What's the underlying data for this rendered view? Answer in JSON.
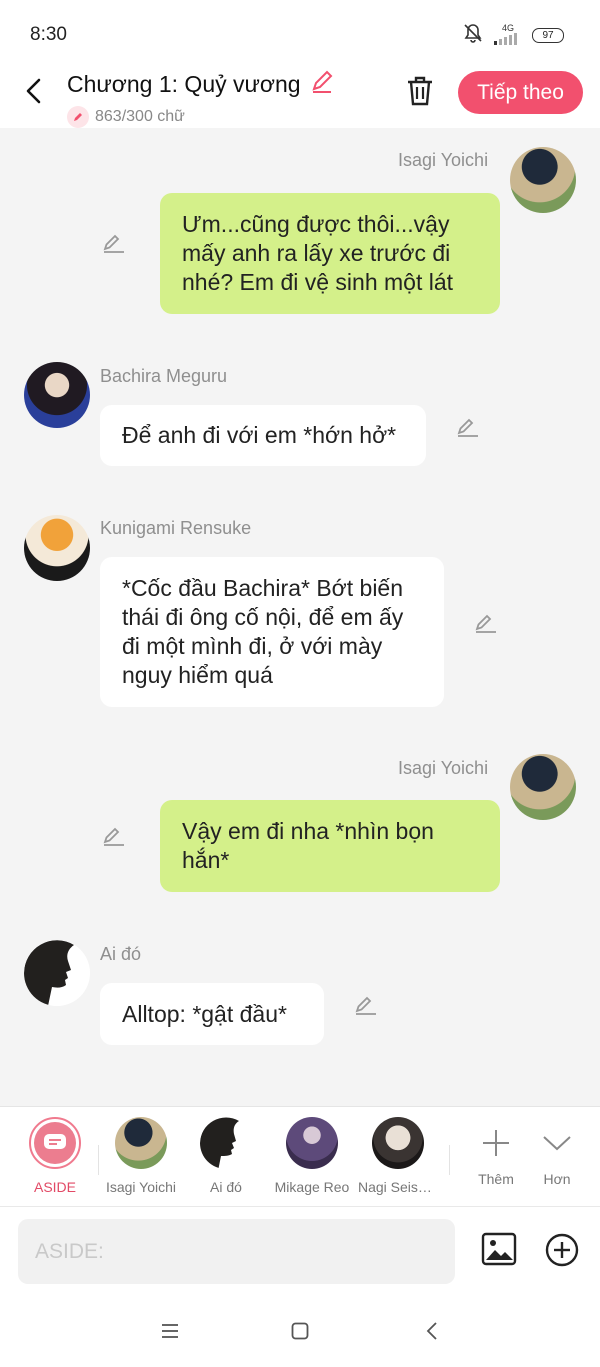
{
  "status": {
    "time": "8:30",
    "network": "4G",
    "battery": "97"
  },
  "header": {
    "title": "Chương 1: Quỷ vương",
    "word_count": "863/300 chữ",
    "next_label": "Tiếp theo"
  },
  "messages": [
    {
      "speaker": "Isagi Yoichi",
      "side": "right",
      "text": "Ưm...cũng được thôi...vậy mấy anh ra lấy xe trước đi nhé? Em đi vệ sinh một lát"
    },
    {
      "speaker": "Bachira Meguru",
      "side": "left",
      "text": "Để anh đi với em *hớn hở*"
    },
    {
      "speaker": "Kunigami Rensuke",
      "side": "left",
      "text": "*Cốc đầu Bachira* Bớt biến thái đi ông cố nội, để em ấy đi một mình đi, ở với mày nguy hiểm quá"
    },
    {
      "speaker": "Isagi Yoichi",
      "side": "right",
      "text": "Vậy em đi nha *nhìn bọn hắn*"
    },
    {
      "speaker": "Ai đó",
      "side": "left",
      "text": "Alltop: *gật đầu*"
    }
  ],
  "roster": {
    "items": [
      {
        "label": "ASIDE"
      },
      {
        "label": "Isagi Yoichi"
      },
      {
        "label": "Ai đó"
      },
      {
        "label": "Mikage Reo"
      },
      {
        "label": "Nagi Seishiro"
      }
    ],
    "add_label": "Thêm",
    "more_label": "Hơn"
  },
  "composer": {
    "placeholder": "ASIDE:"
  },
  "colors": {
    "accent": "#f2506e",
    "bubble_right": "#d4f08a",
    "bubble_left": "#ffffff",
    "background": "#f4f4f4"
  },
  "icons": [
    "back-icon",
    "pencil-icon",
    "trash-icon",
    "edit-icon",
    "image-icon",
    "add-circle-icon",
    "plus-icon",
    "chevron-down-icon",
    "menu-icon",
    "home-icon",
    "nav-back-icon"
  ]
}
